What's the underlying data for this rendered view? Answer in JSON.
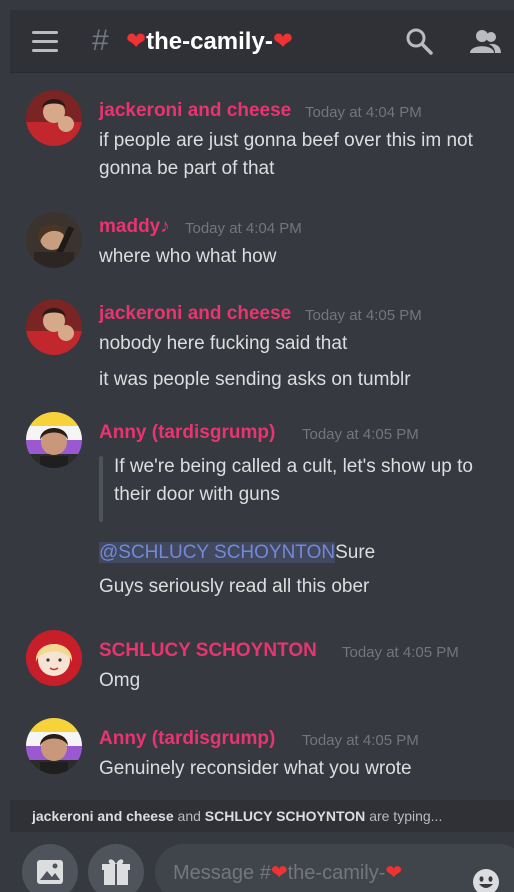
{
  "channel": {
    "prefix": "#",
    "name": "the-camily-",
    "heart": "❤"
  },
  "messages": [
    {
      "author": "jackeroni and cheese",
      "timestamp": "Today at 4:04 PM",
      "lines": [
        "if people are just gonna beef over this im not",
        "gonna be part of that"
      ]
    },
    {
      "author": "maddy♪",
      "timestamp": "Today at 4:04 PM",
      "lines": [
        "where who what how"
      ]
    },
    {
      "author": "jackeroni and cheese",
      "timestamp": "Today at 4:05 PM",
      "lines": [
        "nobody here fucking said that",
        "it was people sending asks on tumblr"
      ]
    },
    {
      "author": "Anny (tardisgrump)",
      "timestamp": "Today at 4:05 PM",
      "quote": [
        "If we're being called a cult, let's show up to",
        "their door with guns"
      ],
      "mention": "@SCHLUCY SCHOYNTON",
      "mention_suffix": "Sure",
      "lines": [
        "Guys seriously read all this ober"
      ]
    },
    {
      "author": "SCHLUCY SCHOYNTON",
      "timestamp": "Today at 4:05 PM",
      "lines": [
        "Omg"
      ]
    },
    {
      "author": "Anny (tardisgrump)",
      "timestamp": "Today at 4:05 PM",
      "lines": [
        "Genuinely reconsider what you wrote"
      ]
    }
  ],
  "typing": {
    "user1": "jackeroni and cheese",
    "and": "and",
    "user2": "SCHLUCY SCHOYNTON",
    "suffix": "are typing..."
  },
  "composer": {
    "placeholder_prefix": "Message #",
    "placeholder_channel": "the-camily-"
  },
  "icons": {
    "menu": "hamburger-icon",
    "search": "search-icon",
    "members": "members-icon",
    "image": "image-icon",
    "gift": "gift-icon",
    "emoji": "emoji-icon"
  },
  "colors": {
    "username": "#e8346f",
    "background": "#36393f",
    "header": "#2f3136",
    "mention": "#7289da"
  }
}
